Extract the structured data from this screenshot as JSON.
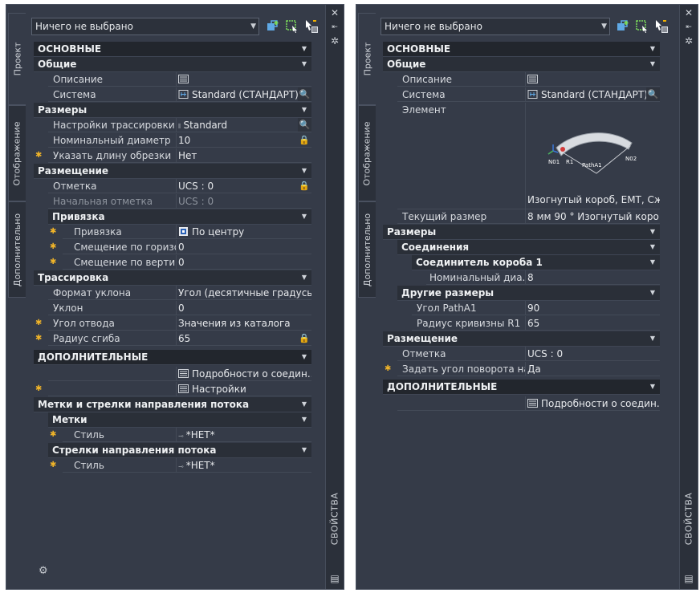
{
  "tabs": {
    "project": "Проект",
    "display": "Отображение",
    "extra": "Дополнительно"
  },
  "strip": {
    "title": "СВОЙСТВА",
    "close_icon": "close-icon",
    "collapse_icon": "autohide-icon",
    "settings_icon": "gear-icon"
  },
  "selector": {
    "value": "Ничего не выбрано"
  },
  "left": {
    "main": "ОСНОВНЫЕ",
    "general": "Общие",
    "description_label": "Описание",
    "system_label": "Система",
    "system_value": "Standard (СТАНДАРТ)",
    "sizes": "Размеры",
    "routing_label": "Настройки трассировки",
    "routing_value": "Standard",
    "diameter_label": "Номинальный диаметр",
    "diameter_value": "10",
    "trim_label": "Указать длину обрезки",
    "trim_value": "Нет",
    "placement": "Размещение",
    "elevation_label": "Отметка",
    "elevation_value": "UCS : 0",
    "start_elev_label": "Начальная отметка",
    "start_elev_value": "UCS : 0",
    "snap": "Привязка",
    "snap_label": "Привязка",
    "snap_value": "По центру",
    "hoff_label": "Смещение по горизо...",
    "hoff_value": "0",
    "voff_label": "Смещение по вертик...",
    "voff_value": "0",
    "route": "Трассировка",
    "slope_fmt_label": "Формат уклона",
    "slope_fmt_value": "Угол (десятичные градусы)",
    "slope_label": "Уклон",
    "slope_value": "0",
    "bend_angle_label": "Угол отвода",
    "bend_angle_value": "Значения из каталога",
    "bend_radius_label": "Радиус сгиба",
    "bend_radius_value": "65",
    "extra": "ДОПОЛНИТЕЛЬНЫЕ",
    "conn_details": "Подробности о соедин...",
    "settings": "Настройки",
    "tags_arrows": "Метки и стрелки направления потока",
    "tags": "Метки",
    "style_label": "Стиль",
    "style_value": "*НЕТ*",
    "flow_arrows": "Стрелки направления потока",
    "style2_label": "Стиль",
    "style2_value": "*НЕТ*"
  },
  "right": {
    "main": "ОСНОВНЫЕ",
    "general": "Общие",
    "description_label": "Описание",
    "system_label": "Система",
    "system_value": "Standard (СТАНДАРТ)",
    "element_label": "Элемент",
    "element_value": "Изогнутый короб, EMT, Сж...",
    "preview_labels": {
      "n01": "N01",
      "r1": "R1",
      "patha1": "PathA1",
      "n02": "N02"
    },
    "cur_size_label": "Текущий размер",
    "cur_size_value": "8 мм 90 ° Изогнутый коро...",
    "sizes": "Размеры",
    "connections": "Соединения",
    "connector": "Соединитель короба 1",
    "nom_dia_label": "Номинальный диа...",
    "nom_dia_value": "8",
    "other_sizes": "Другие размеры",
    "angle_label": "Угол PathA1",
    "angle_value": "90",
    "radius_label": "Радиус кривизны R1",
    "radius_value": "65",
    "placement": "Размещение",
    "elevation_label": "Отметка",
    "elevation_value": "UCS : 0",
    "rot_label": "Задать угол поворота на...",
    "rot_value": "Да",
    "extra": "ДОПОЛНИТЕЛЬНЫЕ",
    "conn_details": "Подробности о соедин..."
  }
}
